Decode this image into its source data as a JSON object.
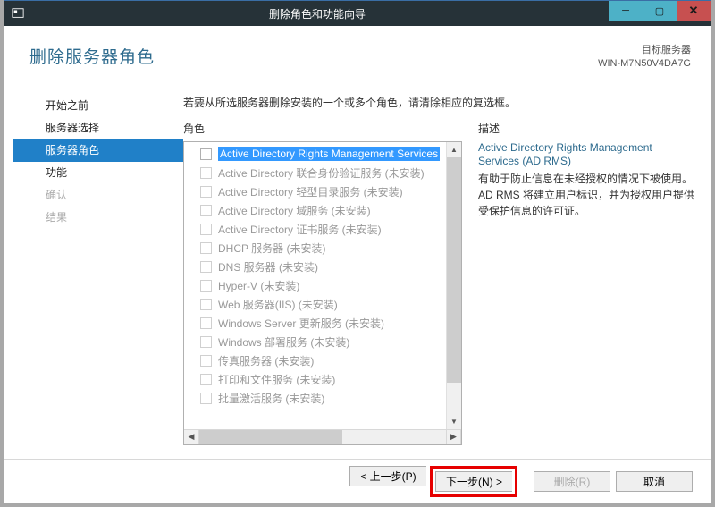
{
  "titlebar": {
    "title": "删除角色和功能向导"
  },
  "header": {
    "page_title": "删除服务器角色",
    "target_label": "目标服务器",
    "server_name": "WIN-M7N50V4DA7G"
  },
  "nav": {
    "items": [
      {
        "label": "开始之前",
        "state": "normal"
      },
      {
        "label": "服务器选择",
        "state": "normal"
      },
      {
        "label": "服务器角色",
        "state": "selected"
      },
      {
        "label": "功能",
        "state": "normal"
      },
      {
        "label": "确认",
        "state": "disabled"
      },
      {
        "label": "结果",
        "state": "disabled"
      }
    ]
  },
  "main": {
    "instruction": "若要从所选服务器删除安装的一个或多个角色，请清除相应的复选框。",
    "roles_label": "角色",
    "desc_label": "描述",
    "roles": [
      {
        "label": "Active Directory Rights Management Services",
        "state": "selected"
      },
      {
        "label": "Active Directory 联合身份验证服务 (未安装)",
        "state": "na"
      },
      {
        "label": "Active Directory 轻型目录服务 (未安装)",
        "state": "na"
      },
      {
        "label": "Active Directory 域服务 (未安装)",
        "state": "na"
      },
      {
        "label": "Active Directory 证书服务 (未安装)",
        "state": "na"
      },
      {
        "label": "DHCP 服务器 (未安装)",
        "state": "na"
      },
      {
        "label": "DNS 服务器 (未安装)",
        "state": "na"
      },
      {
        "label": "Hyper-V (未安装)",
        "state": "na"
      },
      {
        "label": "Web 服务器(IIS) (未安装)",
        "state": "na"
      },
      {
        "label": "Windows Server 更新服务 (未安装)",
        "state": "na"
      },
      {
        "label": "Windows 部署服务 (未安装)",
        "state": "na"
      },
      {
        "label": "传真服务器 (未安装)",
        "state": "na"
      },
      {
        "label": "打印和文件服务 (未安装)",
        "state": "na"
      },
      {
        "label": "批量激活服务 (未安装)",
        "state": "na"
      }
    ],
    "description": {
      "title": "Active Directory Rights Management Services (AD RMS)",
      "body": "有助于防止信息在未经授权的情况下被使用。AD RMS 将建立用户标识，并为授权用户提供受保护信息的许可证。"
    }
  },
  "footer": {
    "prev": "< 上一步(P)",
    "next": "下一步(N) >",
    "remove": "删除(R)",
    "cancel": "取消"
  }
}
